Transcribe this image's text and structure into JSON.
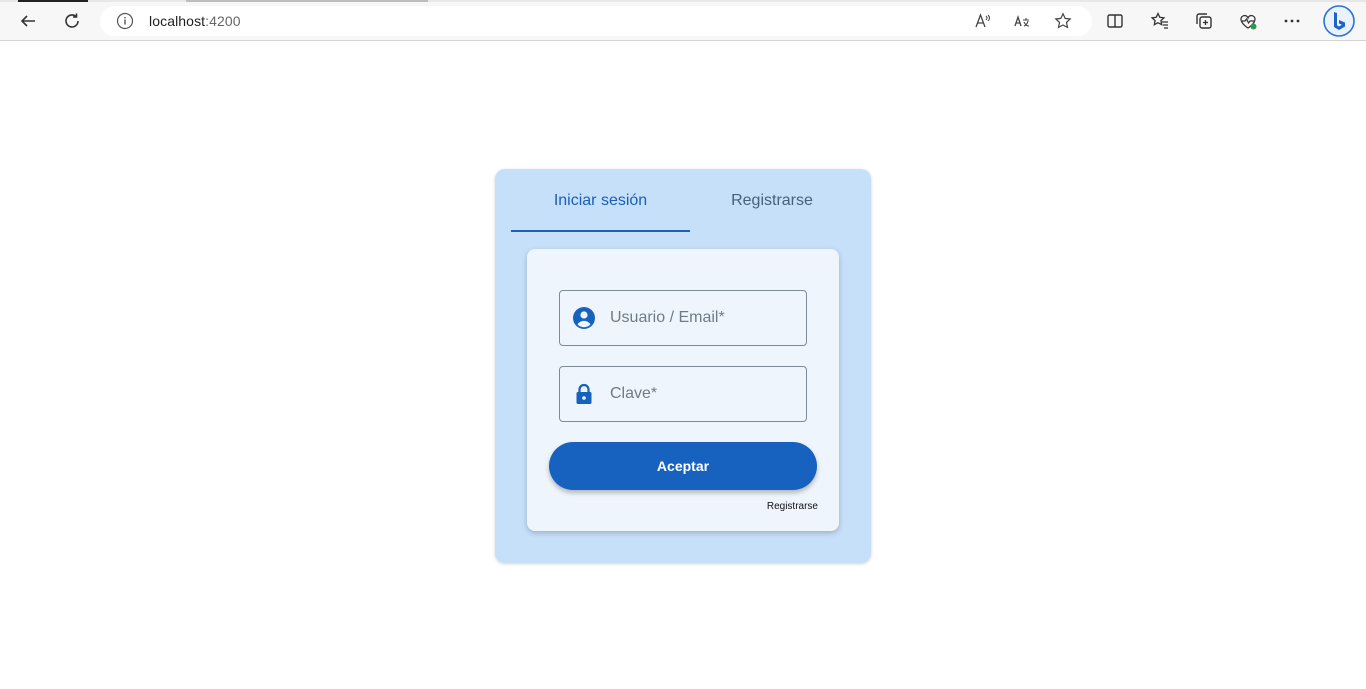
{
  "browser": {
    "url_host": "localhost",
    "url_port": ":4200"
  },
  "login": {
    "tabs": [
      {
        "label": "Iniciar sesión",
        "active": true
      },
      {
        "label": "Registrarse",
        "active": false
      }
    ],
    "username": {
      "placeholder": "Usuario / Email*",
      "icon": "account-circle-icon"
    },
    "password": {
      "placeholder": "Clave*",
      "icon": "lock-icon"
    },
    "submit_label": "Aceptar",
    "register_link": "Registrarse"
  },
  "colors": {
    "outer_bg": "#c7e0fa",
    "inner_bg": "#eff5fd",
    "accent": "#1762bf"
  }
}
